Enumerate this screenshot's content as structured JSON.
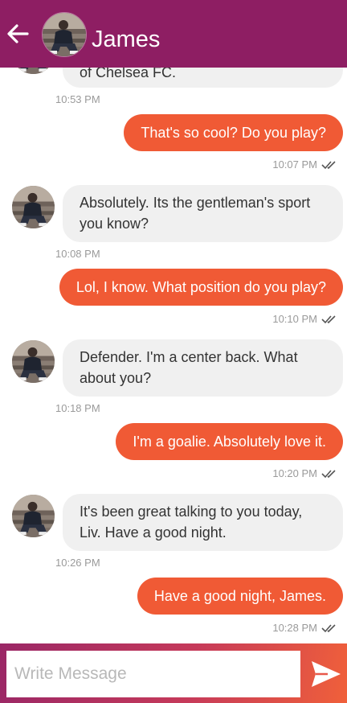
{
  "header": {
    "title": "James",
    "back_icon": "arrow-left-icon",
    "avatar": "contact-avatar"
  },
  "messages": [
    {
      "side": "in",
      "text": "of Chelsea FC.",
      "time": "10:53 PM"
    },
    {
      "side": "out",
      "text": "That's so cool? Do you play?",
      "time": "10:07 PM",
      "status": "read"
    },
    {
      "side": "in",
      "text": "Absolutely. Its the gentleman's sport you know?",
      "time": "10:08 PM"
    },
    {
      "side": "out",
      "text": "Lol, I know. What position do you play?",
      "time": "10:10 PM",
      "status": "read"
    },
    {
      "side": "in",
      "text": "Defender. I'm a center back. What about you?",
      "time": "10:18 PM"
    },
    {
      "side": "out",
      "text": "I'm a goalie. Absolutely love it.",
      "time": "10:20 PM",
      "status": "read"
    },
    {
      "side": "in",
      "text": "It's been great talking to you today, Liv. Have a good night.",
      "time": "10:26 PM"
    },
    {
      "side": "out",
      "text": "Have a good night, James.",
      "time": "10:28 PM",
      "status": "read"
    }
  ],
  "composer": {
    "placeholder": "Write Message",
    "value": "",
    "send_icon": "send-icon"
  },
  "colors": {
    "header": "#8e1e63",
    "outgoing_bubble": "#f05a35",
    "incoming_bubble": "#f0f0f0"
  }
}
